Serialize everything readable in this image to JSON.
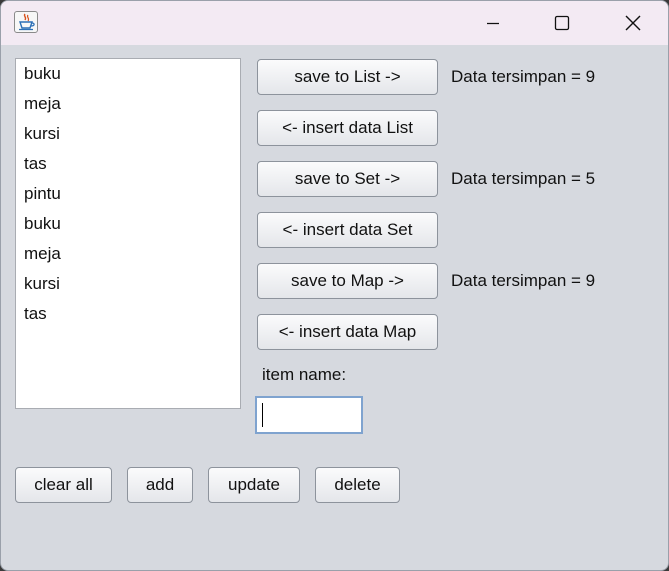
{
  "window": {
    "icon": "java-cup-icon",
    "controls": {
      "minimize": "minimize-icon",
      "maximize": "maximize-icon",
      "close": "close-icon"
    }
  },
  "list": {
    "items": [
      "buku",
      "meja",
      "kursi",
      "tas",
      "pintu",
      "buku",
      "meja",
      "kursi",
      "tas"
    ]
  },
  "buttons": {
    "save_list": "save to List ->",
    "insert_list": "<- insert data List",
    "save_set": "save to Set ->",
    "insert_set": "<- insert data Set",
    "save_map": "save to Map ->",
    "insert_map": "<- insert data Map",
    "clear_all": "clear all",
    "add": "add",
    "update": "update",
    "delete": "delete"
  },
  "status": {
    "list": "Data tersimpan = 9",
    "set": "Data tersimpan = 5",
    "map": "Data tersimpan = 9"
  },
  "form": {
    "item_name_label": "item name:",
    "item_name_value": ""
  }
}
